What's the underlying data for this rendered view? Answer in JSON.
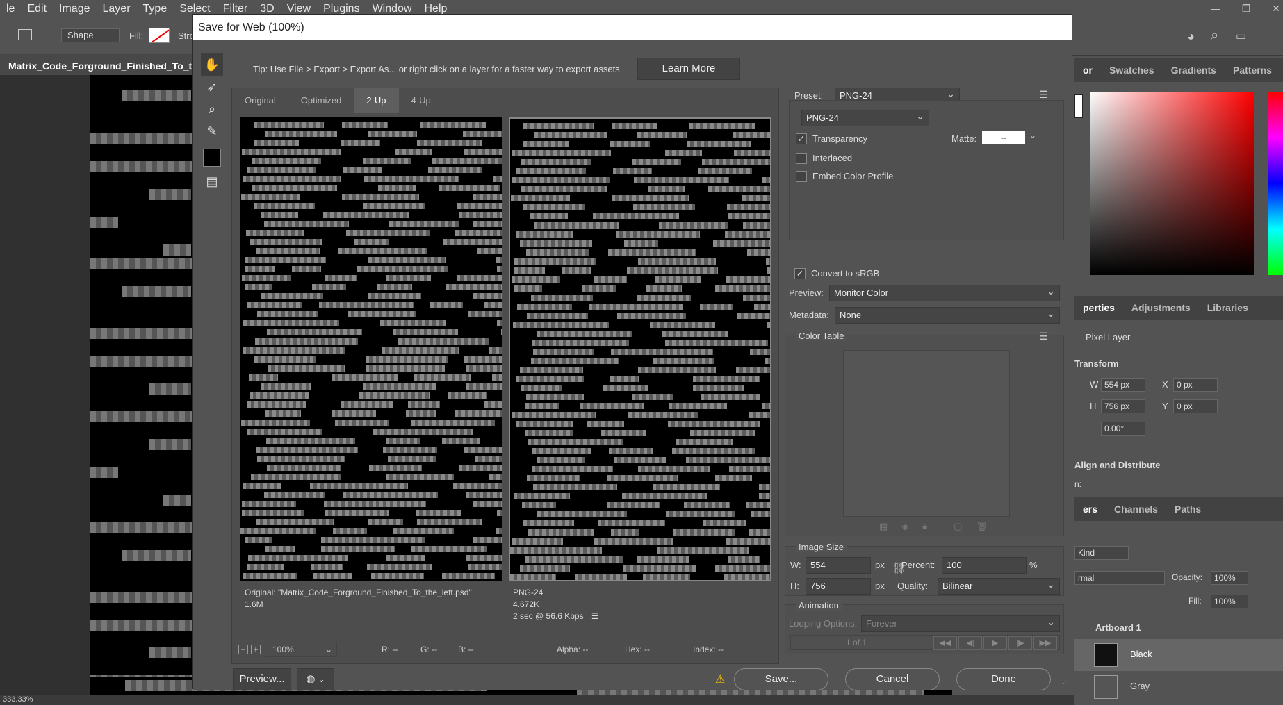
{
  "app": {
    "menu": [
      "le",
      "Edit",
      "Image",
      "Layer",
      "Type",
      "Select",
      "Filter",
      "3D",
      "View",
      "Plugins",
      "Window",
      "Help"
    ],
    "options": {
      "shape_mode": "Shape",
      "fill_label": "Fill:",
      "stroke_label": "Stro"
    },
    "doc_tab": "Matrix_Code_Forground_Finished_To_the",
    "status": "333.33%"
  },
  "right_panel": {
    "color_tabs": [
      "or",
      "Swatches",
      "Gradients",
      "Patterns"
    ],
    "props_tabs": [
      "perties",
      "Adjustments",
      "Libraries"
    ],
    "pixel_layer": "Pixel Layer",
    "transform_title": "Transform",
    "w_label": "W",
    "w": "554 px",
    "x_label": "X",
    "x": "0 px",
    "h_label": "H",
    "h": "756 px",
    "y_label": "Y",
    "y": "0 px",
    "angle": "0.00°",
    "align_title": "Align and Distribute",
    "align_sub": "n:",
    "layer_tabs": [
      "ers",
      "Channels",
      "Paths"
    ],
    "kind": "Kind",
    "blend": "rmal",
    "opacity_label": "Opacity:",
    "opacity": "100%",
    "fill_label": "Fill:",
    "fill": "100%",
    "artboard": "Artboard 1",
    "layer1": "Black",
    "layer2": "Gray"
  },
  "dialog": {
    "title": "Save for Web (100%)",
    "tip": "Tip: Use File > Export > Export As...  or right click on a layer for a faster way to export assets",
    "learn_more": "Learn More",
    "tabs": [
      "Original",
      "Optimized",
      "2-Up",
      "4-Up"
    ],
    "active_tab": "2-Up",
    "left_info": {
      "line1": "Original: \"Matrix_Code_Forground_Finished_To_the_left.psd\"",
      "line2": "1.6M"
    },
    "right_info": {
      "line1": "PNG-24",
      "line2": "4.672K",
      "line3": "2 sec @ 56.6 Kbps"
    },
    "zoom": "100%",
    "readout": {
      "r": "R: --",
      "g": "G: --",
      "b": "B: --",
      "alpha": "Alpha: --",
      "hex": "Hex: --",
      "index": "Index: --"
    },
    "preset_label": "Preset:",
    "preset": "PNG-24",
    "format": "PNG-24",
    "transparency": "Transparency",
    "matte_label": "Matte:",
    "matte": "--",
    "interlaced": "Interlaced",
    "embed": "Embed Color Profile",
    "convert": "Convert to sRGB",
    "preview_label": "Preview:",
    "preview": "Monitor Color",
    "metadata_label": "Metadata:",
    "metadata": "None",
    "color_table": "Color Table",
    "image_size": "Image Size",
    "w_label": "W:",
    "w": "554",
    "h_label": "H:",
    "h": "756",
    "px": "px",
    "percent_label": "Percent:",
    "percent": "100",
    "pct": "%",
    "quality_label": "Quality:",
    "quality": "Bilinear",
    "animation": "Animation",
    "looping_label": "Looping Options:",
    "looping": "Forever",
    "frame": "1 of 1",
    "preview_btn": "Preview...",
    "save": "Save...",
    "cancel": "Cancel",
    "done": "Done"
  }
}
